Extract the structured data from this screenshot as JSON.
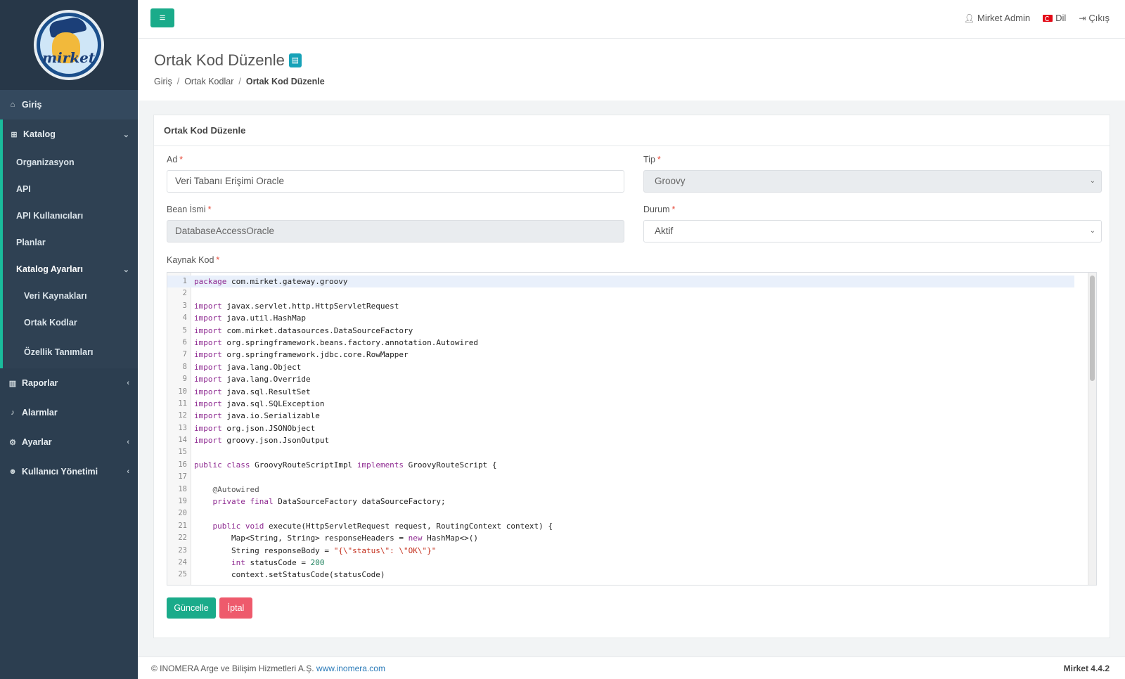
{
  "sidebar": {
    "logo_text": "mirket",
    "items": [
      {
        "label": "Giriş",
        "icon": "home-icon"
      },
      {
        "label": "Katalog",
        "icon": "sitemap-icon"
      },
      {
        "label": "Raporlar",
        "icon": "chart-icon"
      },
      {
        "label": "Alarmlar",
        "icon": "bell-icon"
      },
      {
        "label": "Ayarlar",
        "icon": "gears-icon"
      },
      {
        "label": "Kullanıcı Yönetimi",
        "icon": "users-icon"
      }
    ],
    "catalog_sub": [
      "Organizasyon",
      "API",
      "API Kullanıcıları",
      "Planlar"
    ],
    "catalog_settings": {
      "label": "Katalog Ayarları",
      "items": [
        "Veri Kaynakları",
        "Ortak Kodlar",
        "Özellik Tanımları"
      ]
    }
  },
  "topbar": {
    "menu_icon": "≡",
    "user": "Mirket Admin",
    "language": "Dil",
    "logout": "Çıkış"
  },
  "header": {
    "title": "Ortak Kod Düzenle",
    "breadcrumb": [
      "Giriş",
      "Ortak Kodlar",
      "Ortak Kod Düzenle"
    ]
  },
  "form": {
    "card_title": "Ortak Kod Düzenle",
    "name_label": "Ad",
    "name_value": "Veri Tabanı Erişimi Oracle",
    "type_label": "Tip",
    "type_value": "Groovy",
    "bean_label": "Bean İsmi",
    "bean_value": "DatabaseAccessOracle",
    "status_label": "Durum",
    "status_value": "Aktif",
    "source_label": "Kaynak Kod",
    "required_mark": "*",
    "update_button": "Güncelle",
    "cancel_button": "İptal"
  },
  "code": [
    "package com.mirket.gateway.groovy",
    "",
    "import javax.servlet.http.HttpServletRequest",
    "import java.util.HashMap",
    "import com.mirket.datasources.DataSourceFactory",
    "import org.springframework.beans.factory.annotation.Autowired",
    "import org.springframework.jdbc.core.RowMapper",
    "import java.lang.Object",
    "import java.lang.Override",
    "import java.sql.ResultSet",
    "import java.sql.SQLException",
    "import java.io.Serializable",
    "import org.json.JSONObject",
    "import groovy.json.JsonOutput",
    "",
    "public class GroovyRouteScriptImpl implements GroovyRouteScript {",
    "",
    "    @Autowired",
    "    private final DataSourceFactory dataSourceFactory;",
    "",
    "    public void execute(HttpServletRequest request, RoutingContext context) {",
    "        Map<String, String> responseHeaders = new HashMap<>()",
    "        String responseBody = \"{\\\"status\\\": \\\"OK\\\"}\"",
    "        int statusCode = 200",
    "        context.setStatusCode(statusCode)"
  ],
  "footer": {
    "copyright": "© INOMERA Arge ve Bilişim Hizmetleri A.Ş.",
    "link": "www.inomera.com",
    "version": "Mirket 4.4.2"
  },
  "colors": {
    "sidebar": "#2c3e50",
    "accent": "#1aab8a",
    "danger": "#ee5a6c"
  }
}
